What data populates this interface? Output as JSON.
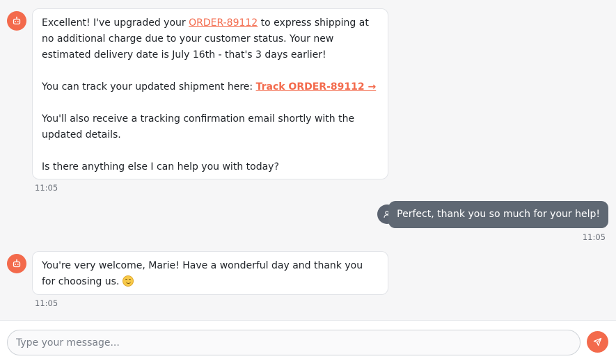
{
  "colors": {
    "accent": "#f36a4c",
    "user_bubble": "#5f6873",
    "background": "#f6f6f7"
  },
  "messages": [
    {
      "sender": "bot",
      "avatar_icon": "bot-icon",
      "para1_before": "Excellent! I've upgraded your ",
      "para1_link": "ORDER-89112",
      "para1_after": " to express shipping at no additional charge due to your customer status. Your new estimated delivery date is July 16th - that's 3 days earlier!",
      "para2_before": "You can track your updated shipment here: ",
      "para2_link": "Track ORDER-89112 →",
      "para3": "You'll also receive a tracking confirmation email shortly with the updated details.",
      "para4": "Is there anything else I can help you with today?",
      "time": "11:05"
    },
    {
      "sender": "user",
      "avatar_icon": "user-icon",
      "text": "Perfect, thank you so much for your help!",
      "time": "11:05"
    },
    {
      "sender": "bot",
      "avatar_icon": "bot-icon",
      "text": "You're very welcome, Marie! Have a wonderful day and thank you for choosing us. ",
      "emoji_icon": "smiling-face-emoji",
      "time": "11:05"
    }
  ],
  "composer": {
    "placeholder": "Type your message...",
    "value": "",
    "send_icon": "send-icon"
  }
}
